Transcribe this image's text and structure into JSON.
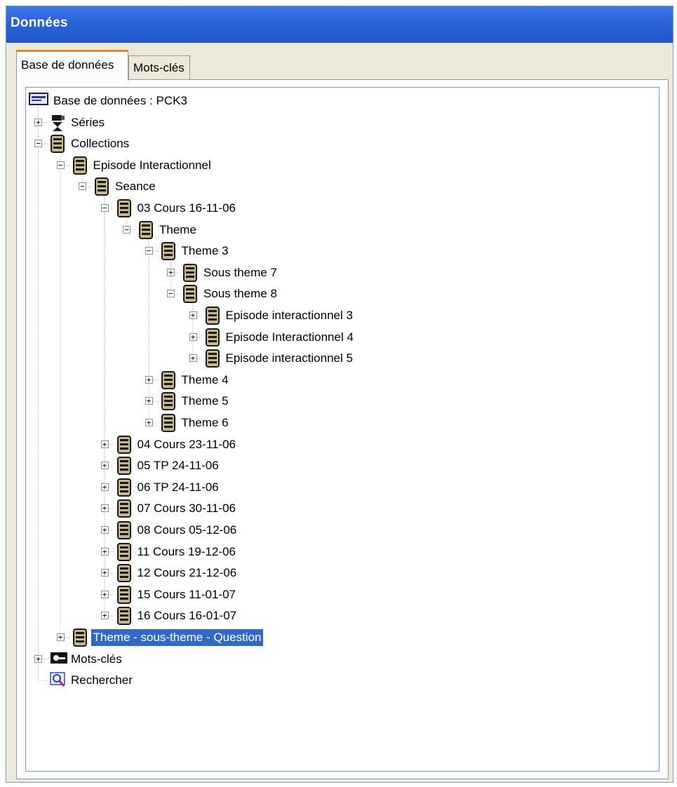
{
  "window": {
    "title": "Données"
  },
  "tabs": [
    {
      "label": "Base de données",
      "active": true
    },
    {
      "label": "Mots-clés",
      "active": false
    }
  ],
  "colors": {
    "titlebar": "#2a64d8",
    "selection": "#316ac5",
    "tab_highlight": "#e68b2c"
  },
  "tree": [
    {
      "label": "Base de données : PCK3",
      "level": 0,
      "expander": "",
      "icon": "database-icon"
    },
    {
      "label": "Séries",
      "level": 1,
      "expander": "+",
      "icon": "series-icon"
    },
    {
      "label": "Collections",
      "level": 1,
      "expander": "-",
      "icon": "collection-icon"
    },
    {
      "label": "Episode Interactionnel",
      "level": 2,
      "expander": "-",
      "icon": "collection-icon"
    },
    {
      "label": "Seance",
      "level": 3,
      "expander": "-",
      "icon": "collection-icon"
    },
    {
      "label": "03 Cours 16-11-06",
      "level": 4,
      "expander": "-",
      "icon": "collection-icon"
    },
    {
      "label": "Theme",
      "level": 5,
      "expander": "-",
      "icon": "collection-icon"
    },
    {
      "label": "Theme 3",
      "level": 6,
      "expander": "-",
      "icon": "collection-icon"
    },
    {
      "label": "Sous theme 7",
      "level": 7,
      "expander": "+",
      "icon": "collection-icon"
    },
    {
      "label": "Sous theme 8",
      "level": 7,
      "expander": "-",
      "icon": "collection-icon"
    },
    {
      "label": "Episode interactionnel 3",
      "level": 8,
      "expander": "+",
      "icon": "collection-icon"
    },
    {
      "label": "Episode Interactionnel 4",
      "level": 8,
      "expander": "+",
      "icon": "collection-icon"
    },
    {
      "label": "Episode interactionnel 5",
      "level": 8,
      "expander": "+",
      "icon": "collection-icon"
    },
    {
      "label": "Theme 4",
      "level": 6,
      "expander": "+",
      "icon": "collection-icon"
    },
    {
      "label": "Theme 5",
      "level": 6,
      "expander": "+",
      "icon": "collection-icon"
    },
    {
      "label": "Theme 6",
      "level": 6,
      "expander": "+",
      "icon": "collection-icon"
    },
    {
      "label": "04 Cours 23-11-06",
      "level": 4,
      "expander": "+",
      "icon": "collection-icon"
    },
    {
      "label": "05 TP 24-11-06",
      "level": 4,
      "expander": "+",
      "icon": "collection-icon"
    },
    {
      "label": "06 TP 24-11-06",
      "level": 4,
      "expander": "+",
      "icon": "collection-icon"
    },
    {
      "label": "07 Cours 30-11-06",
      "level": 4,
      "expander": "+",
      "icon": "collection-icon"
    },
    {
      "label": "08 Cours 05-12-06",
      "level": 4,
      "expander": "+",
      "icon": "collection-icon"
    },
    {
      "label": "11 Cours 19-12-06",
      "level": 4,
      "expander": "+",
      "icon": "collection-icon"
    },
    {
      "label": "12 Cours 21-12-06",
      "level": 4,
      "expander": "+",
      "icon": "collection-icon"
    },
    {
      "label": "15 Cours 11-01-07",
      "level": 4,
      "expander": "+",
      "icon": "collection-icon"
    },
    {
      "label": "16 Cours 16-01-07",
      "level": 4,
      "expander": "+",
      "icon": "collection-icon"
    },
    {
      "label": "Theme - sous-theme - Question",
      "level": 2,
      "expander": "+",
      "icon": "collection-icon",
      "selected": true
    },
    {
      "label": "Mots-clés",
      "level": 1,
      "expander": "+",
      "icon": "keyword-icon"
    },
    {
      "label": "Rechercher",
      "level": 1,
      "expander": "",
      "icon": "search-icon"
    }
  ]
}
